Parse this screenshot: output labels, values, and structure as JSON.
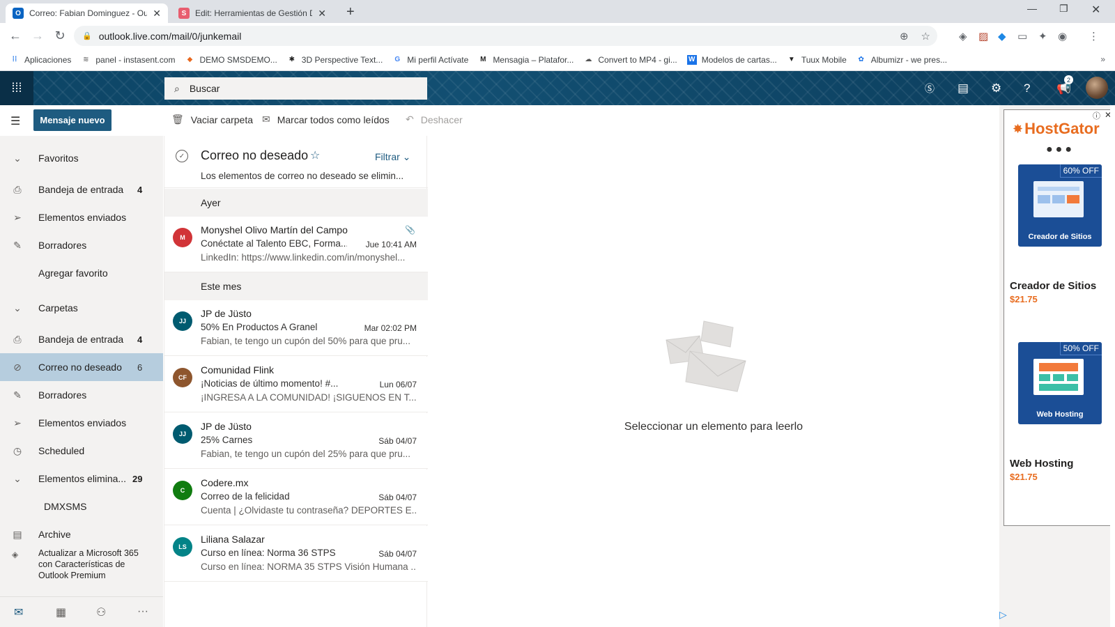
{
  "browser": {
    "tabs": [
      {
        "title": "Correo: Fabian Dominguez - Outl",
        "icon": "outlook-icon",
        "active": true
      },
      {
        "title": "Edit: Herramientas de Gestión Di",
        "icon": "s-icon",
        "active": false
      }
    ],
    "url": "outlook.live.com/mail/0/junkemail",
    "bookmarks": [
      {
        "label": "Aplicaciones",
        "icon": "apps-grid-icon"
      },
      {
        "label": "panel - instasent.com",
        "icon": "wing-icon"
      },
      {
        "label": "DEMO SMSDEMO...",
        "icon": "diamond-icon"
      },
      {
        "label": "3D Perspective Text...",
        "icon": "figure-icon"
      },
      {
        "label": "Mi perfil Actívate",
        "icon": "google-icon"
      },
      {
        "label": "Mensagia – Platafor...",
        "icon": "m-icon"
      },
      {
        "label": "Convert to MP4 - gi...",
        "icon": "convert-icon"
      },
      {
        "label": "Modelos de cartas...",
        "icon": "w-icon"
      },
      {
        "label": "Tuux Mobile",
        "icon": "tuux-icon"
      },
      {
        "label": "Albumizr - we pres...",
        "icon": "gear-blue-icon"
      }
    ]
  },
  "outlook": {
    "search_placeholder": "Buscar",
    "new_message": "Mensaje nuevo",
    "commands": {
      "empty_folder": "Vaciar carpeta",
      "mark_all_read": "Marcar todos como leídos",
      "undo": "Deshacer"
    },
    "header_badge": "2",
    "nav": {
      "favorites_label": "Favoritos",
      "favorites": [
        {
          "label": "Bandeja de entrada",
          "count": "4",
          "icon": "inbox-icon"
        },
        {
          "label": "Elementos enviados",
          "count": "",
          "icon": "send-icon"
        },
        {
          "label": "Borradores",
          "count": "",
          "icon": "pencil-icon"
        },
        {
          "label": "Agregar favorito",
          "count": "",
          "icon": ""
        }
      ],
      "folders_label": "Carpetas",
      "folders": [
        {
          "label": "Bandeja de entrada",
          "count": "4",
          "icon": "inbox-icon"
        },
        {
          "label": "Correo no deseado",
          "count": "6",
          "icon": "block-icon",
          "selected": true
        },
        {
          "label": "Borradores",
          "count": "",
          "icon": "pencil-icon"
        },
        {
          "label": "Elementos enviados",
          "count": "",
          "icon": "send-icon"
        },
        {
          "label": "Scheduled",
          "count": "",
          "icon": "clock-icon"
        },
        {
          "label": "Elementos elimina...",
          "count": "29",
          "icon": "chevron-down-icon"
        },
        {
          "label": "DMXSMS",
          "count": "",
          "icon": ""
        },
        {
          "label": "Archive",
          "count": "",
          "icon": "archive-icon"
        }
      ],
      "upgrade": "Actualizar a Microsoft 365 con Características de Outlook Premium"
    },
    "list": {
      "title": "Correo no deseado",
      "filter": "Filtrar",
      "subtitle": "Los elementos de correo no deseado se elimin...",
      "groups": [
        "Ayer",
        "Este mes"
      ],
      "messages": [
        {
          "initials": "M",
          "color": "#d13438",
          "from": "Monyshel Olivo Martín del Campo",
          "subject": "Conéctate al Talento EBC, Forma...",
          "date": "Jue 10:41 AM",
          "preview": "LinkedIn: https://www.linkedin.com/in/monyshel...",
          "attachment": true
        },
        {
          "initials": "JJ",
          "color": "#005b70",
          "from": "JP de Jüsto",
          "subject": "50% En Productos A Granel",
          "date": "Mar 02:02 PM",
          "preview": "Fabian, te tengo un cupón del 50% para que pru..."
        },
        {
          "initials": "CF",
          "color": "#8e562e",
          "from": "Comunidad Flink",
          "subject": "¡Noticias de último momento! #...",
          "date": "Lun 06/07",
          "preview": "¡INGRESA A LA COMUNIDAD! ¡SIGUENOS EN T..."
        },
        {
          "initials": "JJ",
          "color": "#005b70",
          "from": "JP de Jüsto",
          "subject": "25% Carnes",
          "date": "Sáb 04/07",
          "preview": "Fabian, te tengo un cupón del 25% para que pru..."
        },
        {
          "initials": "C",
          "color": "#107c10",
          "from": "Codere.mx",
          "subject": "Correo de la felicidad",
          "date": "Sáb 04/07",
          "preview": "Cuenta | ¿Olvidaste tu contraseña? DEPORTES E..."
        },
        {
          "initials": "LS",
          "color": "#038387",
          "from": "Liliana Salazar",
          "subject": "Curso en línea: Norma 36 STPS",
          "date": "Sáb 04/07",
          "preview": "Curso en línea: NORMA 35 STPS Visión Humana ..."
        }
      ]
    },
    "reading_pane": "Seleccionar un elemento para leerlo"
  },
  "ad": {
    "brand": "HostGator",
    "items": [
      {
        "badge": "60% OFF",
        "caption": "Creador de Sitios",
        "title": "Creador de Sitios",
        "price": "$21.75"
      },
      {
        "badge": "50% OFF",
        "caption": "Web Hosting",
        "title": "Web Hosting",
        "price": "$21.75"
      }
    ]
  }
}
